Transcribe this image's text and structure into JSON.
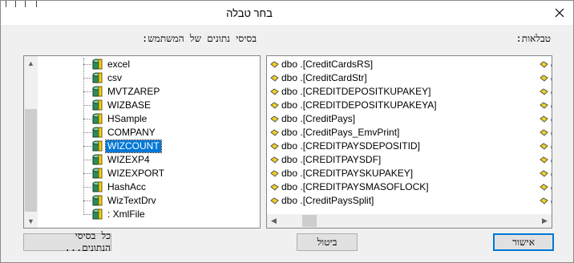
{
  "window": {
    "title": "בחר טבלה"
  },
  "left_label": "בסיסי נתונים של המשתמש:",
  "right_label": "טבלאות:",
  "databases": [
    {
      "label": "excel",
      "selected": false
    },
    {
      "label": "csv",
      "selected": false
    },
    {
      "label": "MVTZAREP",
      "selected": false
    },
    {
      "label": "WIZBASE",
      "selected": false
    },
    {
      "label": "HSample",
      "selected": false
    },
    {
      "label": "COMPANY",
      "selected": false
    },
    {
      "label": "WIZCOUNT",
      "selected": true
    },
    {
      "label": "WIZEXP4",
      "selected": false
    },
    {
      "label": "WIZEXPORT",
      "selected": false
    },
    {
      "label": "HashAcc",
      "selected": false
    },
    {
      "label": "WizTextDrv",
      "selected": false
    },
    {
      "label": ": XmlFile",
      "selected": false
    }
  ],
  "tables": [
    {
      "label": "dbo .[CreditCardsRS]",
      "right": "d"
    },
    {
      "label": "dbo .[CreditCardStr]",
      "right": "d"
    },
    {
      "label": "dbo .[CREDITDEPOSITKUPAKEY]",
      "right": "d"
    },
    {
      "label": "dbo .[CREDITDEPOSITKUPAKEYA]",
      "right": "d"
    },
    {
      "label": "dbo .[CreditPays]",
      "right": "d"
    },
    {
      "label": "dbo .[CreditPays_EmvPrint]",
      "right": "d"
    },
    {
      "label": "dbo .[CREDITPAYSDEPOSITID]",
      "right": "d"
    },
    {
      "label": "dbo .[CREDITPAYSDF]",
      "right": "d"
    },
    {
      "label": "dbo .[CREDITPAYSKUPAKEY]",
      "right": "d"
    },
    {
      "label": "dbo .[CREDITPAYSMASOFLOCK]",
      "right": "d"
    },
    {
      "label": "dbo .[CreditPaysSplit]",
      "right": "d"
    }
  ],
  "buttons": {
    "all_databases": "כל בסיסי הנתונים...",
    "cancel": "ביטול",
    "ok": "אישור"
  },
  "icons": {
    "close": "close-icon",
    "database": "database-icon",
    "table": "table-icon",
    "scroll_up": "arrow-up-icon",
    "scroll_down": "arrow-down-icon",
    "scroll_left": "arrow-left-icon",
    "scroll_right": "arrow-right-icon"
  },
  "colors": {
    "selection": "#0078d7",
    "db_icon_fill": "#2a8c5a",
    "table_icon_fill": "#f2d21b"
  }
}
